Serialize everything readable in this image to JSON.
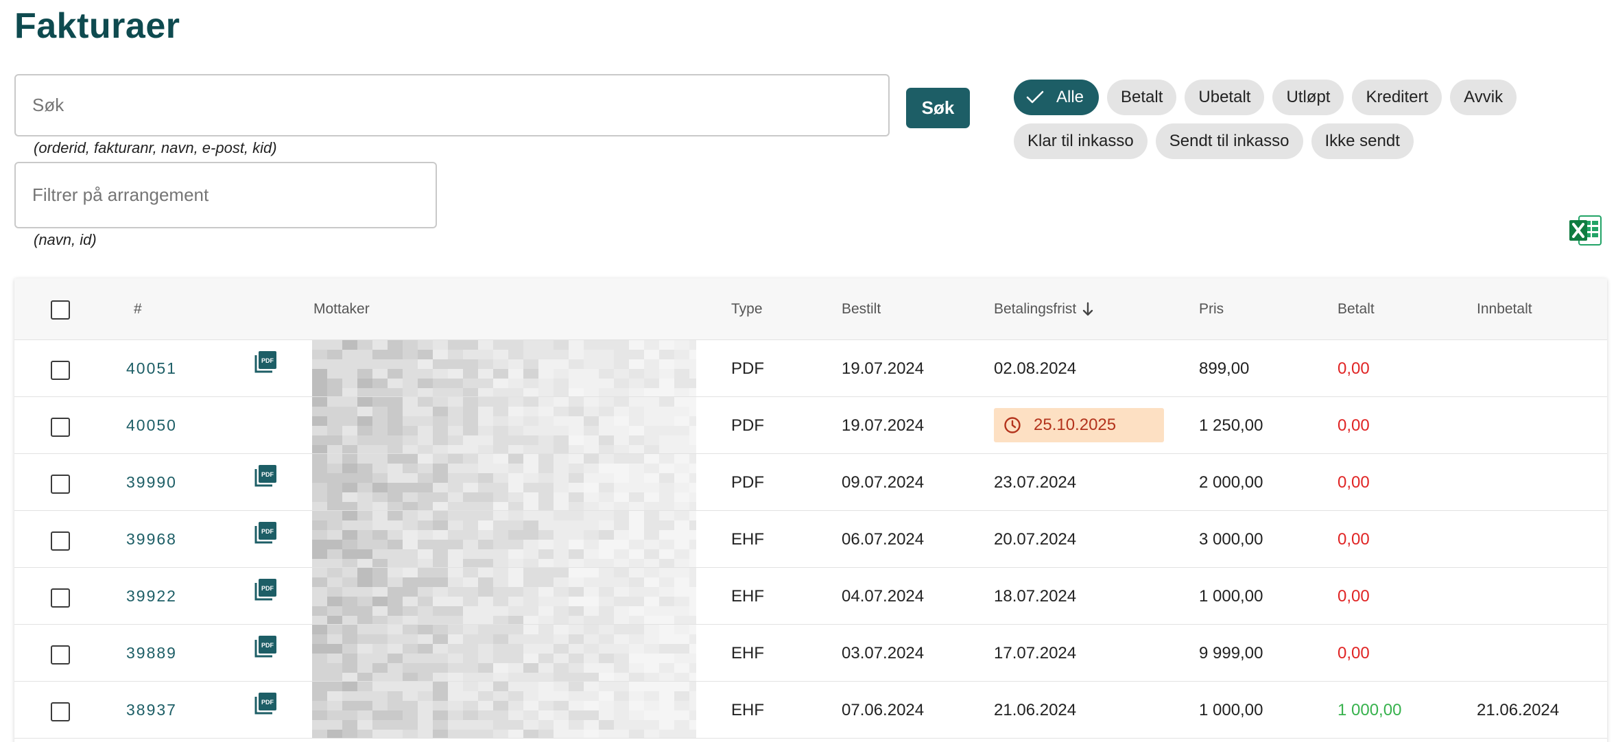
{
  "page": {
    "title": "Fakturaer"
  },
  "search": {
    "placeholder": "Søk",
    "hint": "(orderid, fakturanr, navn, e-post, kid)",
    "button_label": "Søk"
  },
  "event_filter": {
    "placeholder": "Filtrer på arrangement",
    "hint": "(navn, id)"
  },
  "status_filters": {
    "row1": [
      {
        "label": "Alle",
        "active": true
      },
      {
        "label": "Betalt",
        "active": false
      },
      {
        "label": "Ubetalt",
        "active": false
      },
      {
        "label": "Utløpt",
        "active": false
      },
      {
        "label": "Kreditert",
        "active": false
      },
      {
        "label": "Avvik",
        "active": false
      }
    ],
    "row2": [
      {
        "label": "Klar til inkasso",
        "active": false
      },
      {
        "label": "Sendt til inkasso",
        "active": false
      },
      {
        "label": "Ikke sendt",
        "active": false
      }
    ]
  },
  "icons": {
    "excel": "excel-export-icon",
    "pdf": "pdf-icon",
    "check": "check-icon",
    "clock": "clock-icon",
    "sort": "arrow-down-icon"
  },
  "colors": {
    "primary": "#1d5e66",
    "title": "#0e4a4f",
    "unpaid": "#e02424",
    "paid": "#37b24d",
    "overdue_bg": "#fde0c3",
    "overdue_text": "#b3331c"
  },
  "table": {
    "columns": {
      "number": "#",
      "recipient": "Mottaker",
      "type": "Type",
      "ordered": "Bestilt",
      "due": "Betalingsfrist",
      "price": "Pris",
      "paid": "Betalt",
      "received": "Innbetalt"
    },
    "rows": [
      {
        "order": "40051",
        "has_pdf": true,
        "type": "PDF",
        "ordered": "19.07.2024",
        "due": "02.08.2024",
        "overdue": false,
        "price": "899,00",
        "paid": "0,00",
        "paid_status": "unpaid",
        "received": ""
      },
      {
        "order": "40050",
        "has_pdf": false,
        "type": "PDF",
        "ordered": "19.07.2024",
        "due": "25.10.2025",
        "overdue": true,
        "price": "1 250,00",
        "paid": "0,00",
        "paid_status": "unpaid",
        "received": ""
      },
      {
        "order": "39990",
        "has_pdf": true,
        "type": "PDF",
        "ordered": "09.07.2024",
        "due": "23.07.2024",
        "overdue": false,
        "price": "2 000,00",
        "paid": "0,00",
        "paid_status": "unpaid",
        "received": ""
      },
      {
        "order": "39968",
        "has_pdf": true,
        "type": "EHF",
        "ordered": "06.07.2024",
        "due": "20.07.2024",
        "overdue": false,
        "price": "3 000,00",
        "paid": "0,00",
        "paid_status": "unpaid",
        "received": ""
      },
      {
        "order": "39922",
        "has_pdf": true,
        "type": "EHF",
        "ordered": "04.07.2024",
        "due": "18.07.2024",
        "overdue": false,
        "price": "1 000,00",
        "paid": "0,00",
        "paid_status": "unpaid",
        "received": ""
      },
      {
        "order": "39889",
        "has_pdf": true,
        "type": "EHF",
        "ordered": "03.07.2024",
        "due": "17.07.2024",
        "overdue": false,
        "price": "9 999,00",
        "paid": "0,00",
        "paid_status": "unpaid",
        "received": ""
      },
      {
        "order": "38937",
        "has_pdf": true,
        "type": "EHF",
        "ordered": "07.06.2024",
        "due": "21.06.2024",
        "overdue": false,
        "price": "1 000,00",
        "paid": "1 000,00",
        "paid_status": "paid",
        "received": "21.06.2024"
      }
    ]
  }
}
